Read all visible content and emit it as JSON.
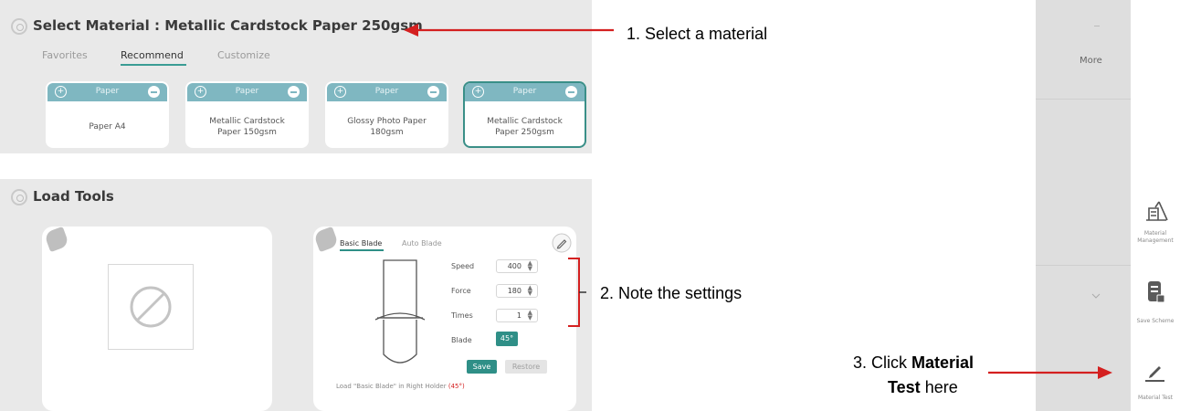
{
  "material_panel": {
    "title": "Select Material : Metallic Cardstock Paper 250gsm",
    "tabs": [
      {
        "label": "Favorites",
        "active": false
      },
      {
        "label": "Recommend",
        "active": true
      },
      {
        "label": "Customize",
        "active": false
      }
    ],
    "cards": [
      {
        "header": "Paper",
        "name": "Paper A4",
        "selected": false
      },
      {
        "header": "Paper",
        "name": "Metallic Cardstock\nPaper 150gsm",
        "selected": false
      },
      {
        "header": "Paper",
        "name": "Glossy Photo Paper\n180gsm",
        "selected": false
      },
      {
        "header": "Paper",
        "name": "Metallic Cardstock\nPaper 250gsm",
        "selected": true
      }
    ]
  },
  "tools_panel": {
    "title": "Load Tools",
    "right_holder": {
      "tabs": [
        {
          "label": "Basic Blade",
          "active": true
        },
        {
          "label": "Auto Blade",
          "active": false
        }
      ],
      "settings": [
        {
          "label": "Speed",
          "value": "400"
        },
        {
          "label": "Force",
          "value": "180"
        },
        {
          "label": "Times",
          "value": "1"
        }
      ],
      "blade_label": "Blade",
      "blade_value": "45°",
      "save_label": "Save",
      "reset_label": "Restore",
      "footer_prefix": "Load \"Basic Blade\" in Right Holder ",
      "footer_highlight": "(45°)"
    }
  },
  "annotations": {
    "step1": "1. Select a material",
    "step2": "2. Note the settings",
    "step3_prefix": "3. Click ",
    "step3_bold": "Material",
    "step3_line2_bold": "Test",
    "step3_line2_suffix": " here"
  },
  "sidebar": {
    "more_label": "More",
    "items": [
      {
        "icon": "material-management-icon",
        "label": "Material Management"
      },
      {
        "icon": "save-scheme-icon",
        "label": "Save Scheme"
      },
      {
        "icon": "material-test-icon",
        "label": "Material Test"
      }
    ]
  },
  "colors": {
    "accent": "#2f8f87",
    "card_header": "#7fb7c1",
    "annotation_red": "#d42020"
  }
}
